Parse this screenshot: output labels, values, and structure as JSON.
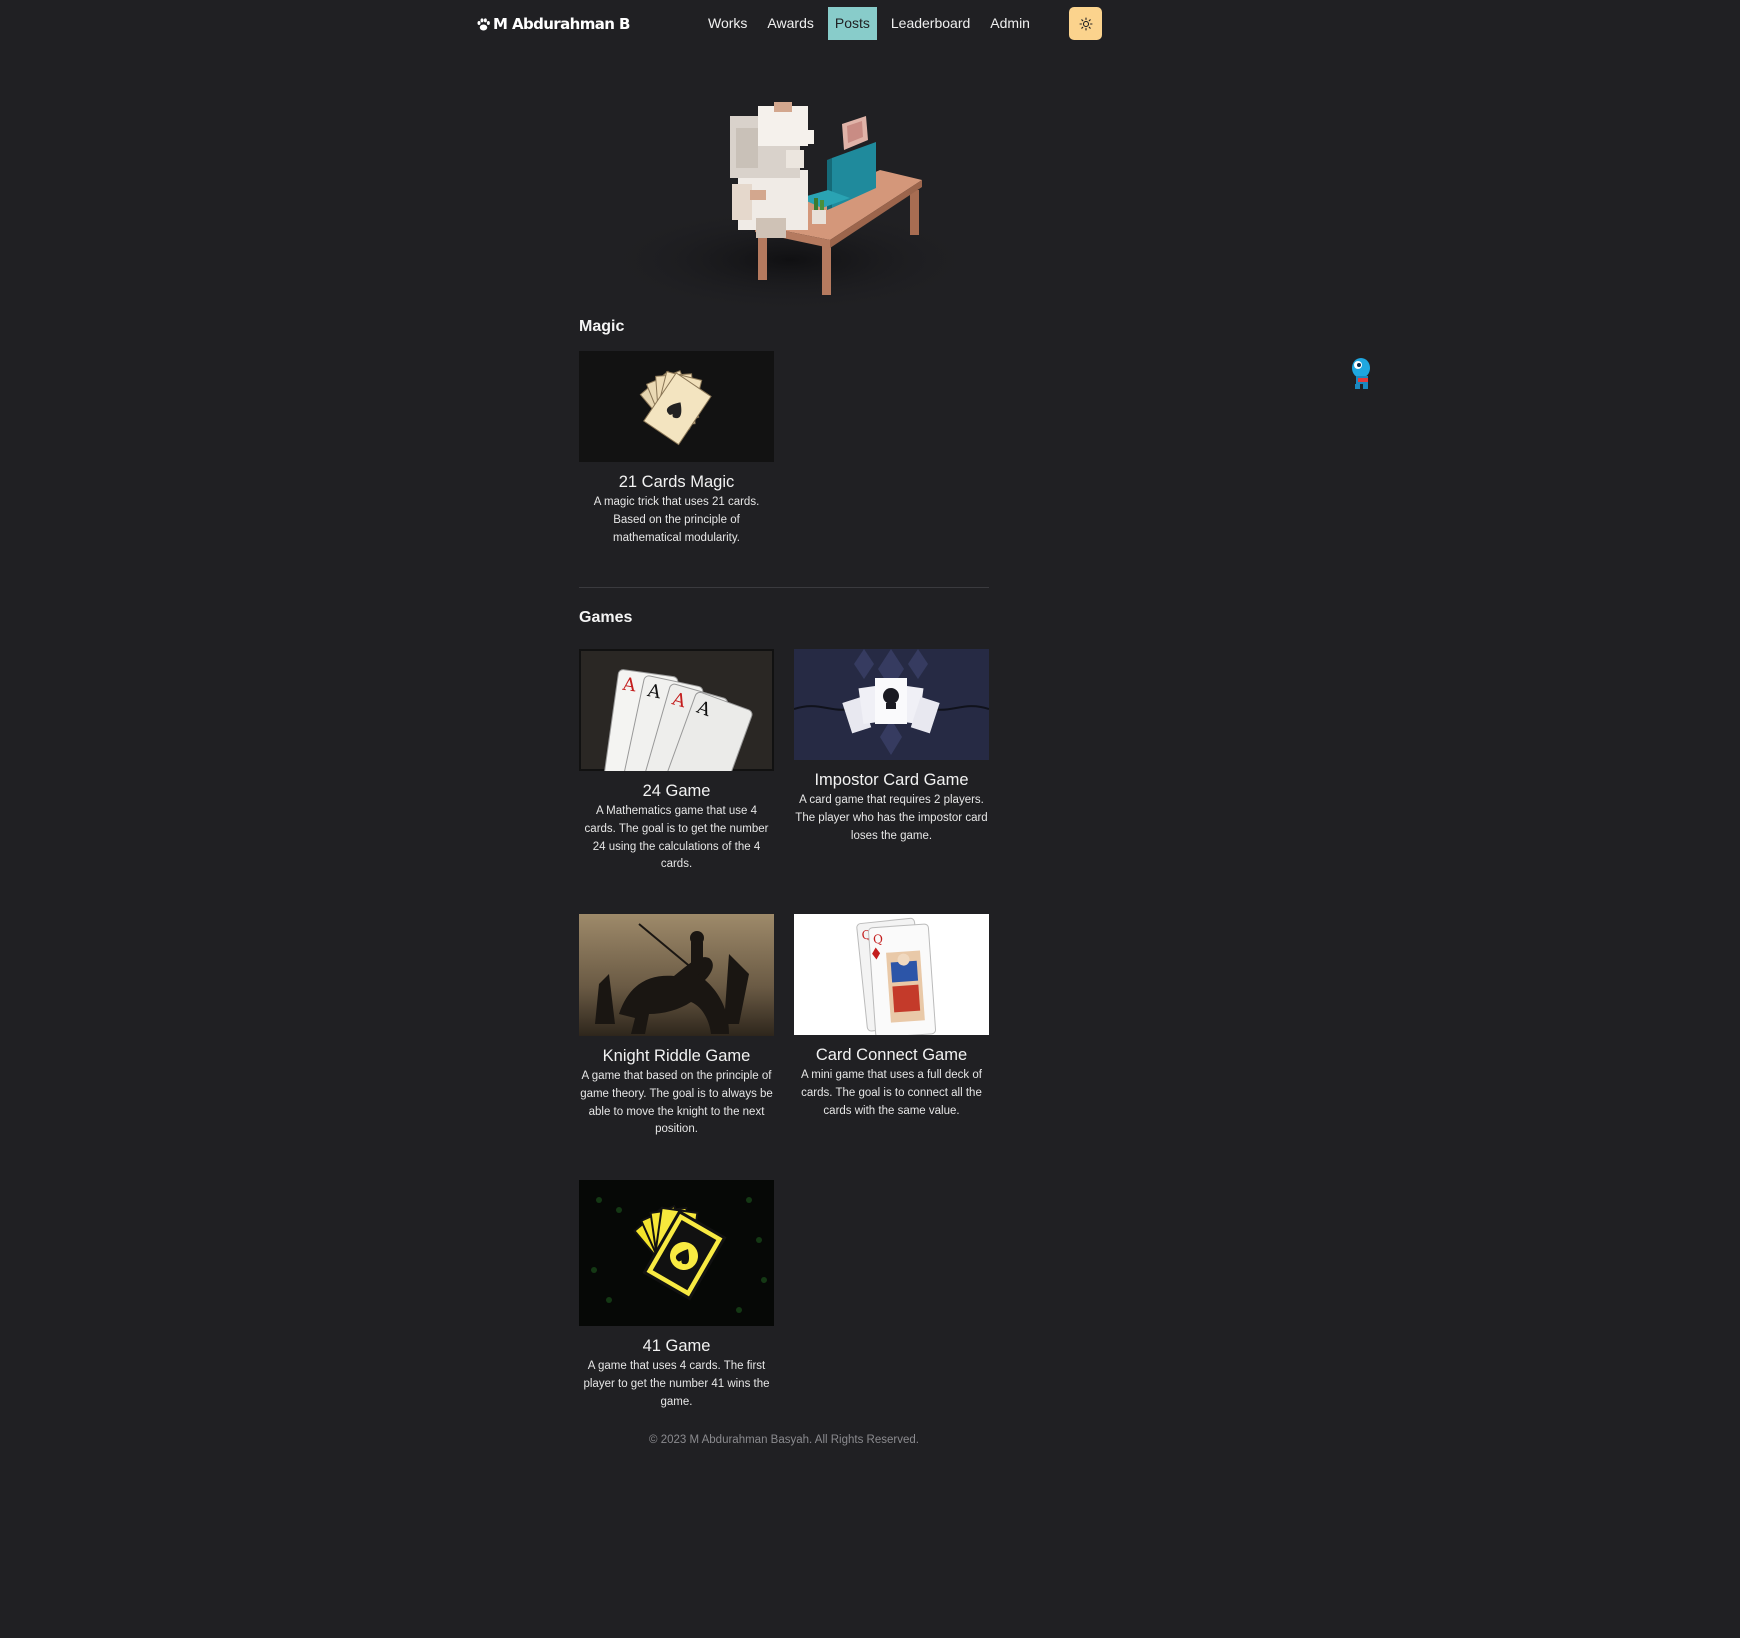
{
  "nav": {
    "brand": "M Abdurahman B",
    "brand_icon": "paw-icon",
    "links": [
      "Works",
      "Awards",
      "Posts",
      "Leaderboard",
      "Admin"
    ],
    "active": "Posts",
    "theme_icon": "sun-icon",
    "accent": "#88ccca",
    "theme_button_color": "#fbd38d"
  },
  "sections": {
    "magic": {
      "title": "Magic",
      "cards": [
        {
          "title": "21 Cards Magic",
          "desc": "A magic trick that uses 21 cards. Based on the principle of mathematical modularity."
        }
      ]
    },
    "games": {
      "title": "Games",
      "cards": [
        {
          "title": "24 Game",
          "desc": "A Mathematics game that use 4 cards. The goal is to get the number 24 using the calculations of the 4 cards."
        },
        {
          "title": "Impostor Card Game",
          "desc": "A card game that requires 2 players. The player who has the impostor card loses the game."
        },
        {
          "title": "Knight Riddle Game",
          "desc": "A game that based on the principle of game theory. The goal is to always be able to move the knight to the next position."
        },
        {
          "title": "Card Connect Game",
          "desc": "A mini game that uses a full deck of cards. The goal is to connect all the cards with the same value."
        },
        {
          "title": "41 Game",
          "desc": "A game that uses 4 cards. The first player to get the number 41 wins the game."
        }
      ]
    }
  },
  "footer": "© 2023 M Abdurahman Basyah. All Rights Reserved.",
  "background": "#202023"
}
